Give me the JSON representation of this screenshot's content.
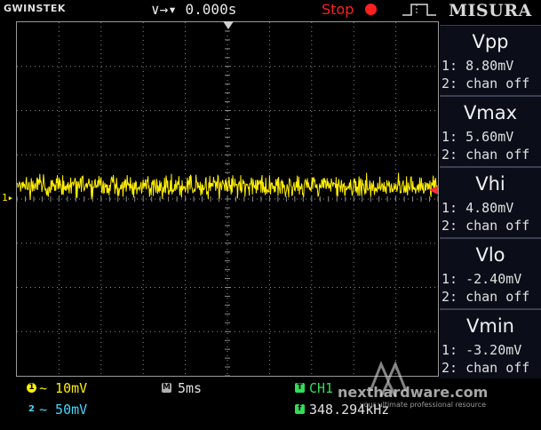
{
  "header": {
    "brand": "GWINSTEK",
    "trigger_delay": "∨→▾ 0.000s",
    "run_status": "Stop",
    "misura_label": "MISURA"
  },
  "waveform": {
    "channel_marker": "1▸",
    "color": "#ffee00",
    "level_fraction": 0.465,
    "noise_fraction": 0.045
  },
  "measurements": [
    {
      "title": "Vpp",
      "ch1": "1: 8.80mV",
      "ch2": "2: chan off"
    },
    {
      "title": "Vmax",
      "ch1": "1: 5.60mV",
      "ch2": "2: chan off"
    },
    {
      "title": "Vhi",
      "ch1": "1: 4.80mV",
      "ch2": "2: chan off"
    },
    {
      "title": "Vlo",
      "ch1": "1: -2.40mV",
      "ch2": "2: chan off"
    },
    {
      "title": "Vmin",
      "ch1": "1: -3.20mV",
      "ch2": "2: chan off"
    }
  ],
  "footer": {
    "ch1_badge": "1",
    "ch1_scale": "∼ 10mV",
    "ch2_badge": "2",
    "ch2_scale": "∼ 50mV",
    "time_badge": "M",
    "time_scale": "5ms",
    "trigger_badge": "T",
    "trigger_source": "CH1",
    "freq_badge": "f",
    "frequency": "348.294kHz"
  },
  "watermark": {
    "title": "nexthardware.com",
    "subtitle": "your ultimate professional resource"
  },
  "colors": {
    "ch1": "#ffee00",
    "ch2": "#44d8ff",
    "trigger": "#33dd55",
    "stop": "#ff2020"
  }
}
